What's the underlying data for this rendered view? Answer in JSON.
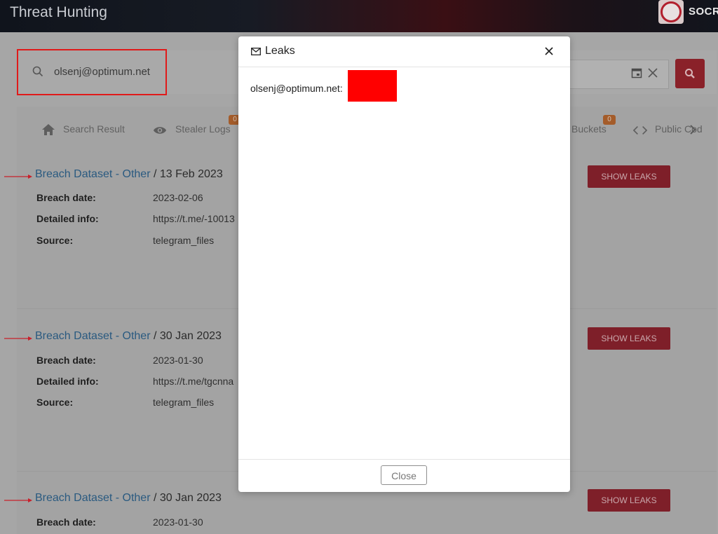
{
  "app": {
    "title": "Threat Hunting",
    "brand": "SOCR"
  },
  "search": {
    "query": "olsenj@optimum.net"
  },
  "tabs": [
    {
      "label": "Search Result",
      "icon": "home-icon"
    },
    {
      "label": "Stealer Logs",
      "icon": "eye-icon",
      "badge": "0"
    },
    {
      "label": "Buckets",
      "icon": "bucket-icon",
      "badge": "0"
    },
    {
      "label": "Public Cod",
      "icon": "code-icon"
    }
  ],
  "results": [
    {
      "title_link": "Breach Dataset - Other",
      "separator": " / ",
      "date": "13 Feb 2023",
      "fields": [
        {
          "label": "Breach date:",
          "value": "2023-02-06"
        },
        {
          "label": "Detailed info:",
          "value": "https://t.me/-10013"
        },
        {
          "label": "Source:",
          "value": "telegram_files"
        }
      ],
      "button": "SHOW LEAKS"
    },
    {
      "title_link": "Breach Dataset - Other",
      "separator": " / ",
      "date": "30 Jan 2023",
      "fields": [
        {
          "label": "Breach date:",
          "value": "2023-01-30"
        },
        {
          "label": "Detailed info:",
          "value": "https://t.me/tgcnna"
        },
        {
          "label": "Source:",
          "value": "telegram_files"
        }
      ],
      "button": "SHOW LEAKS"
    },
    {
      "title_link": "Breach Dataset - Other",
      "separator": " / ",
      "date": "30 Jan 2023",
      "fields": [
        {
          "label": "Breach date:",
          "value": "2023-01-30"
        }
      ],
      "button": "SHOW LEAKS"
    }
  ],
  "modal": {
    "title": "Leaks",
    "body_text": "olsenj@optimum.net:",
    "close_label": "Close"
  },
  "colors": {
    "accent": "#c62f3d",
    "highlight": "#e01a1a",
    "link": "#2f7fc1",
    "redaction": "#ff0000"
  }
}
